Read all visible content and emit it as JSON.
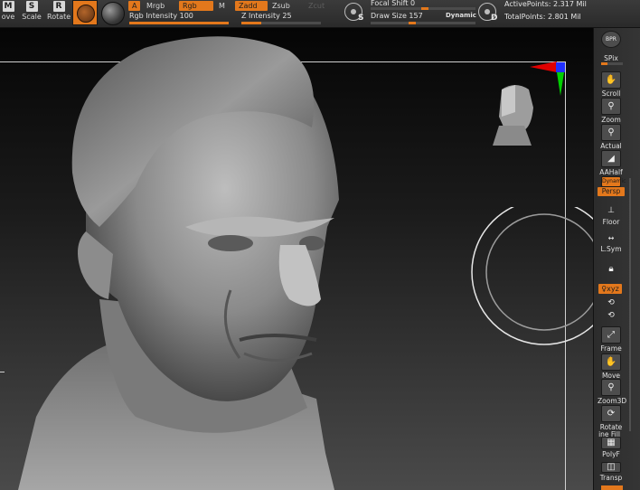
{
  "toolbar": {
    "move_label": "ove",
    "scale_label": "Scale",
    "rotate_label": "Rotate",
    "move_key": "M",
    "scale_key": "S",
    "rotate_key": "R",
    "a_label": "A",
    "mrgb_label": "Mrgb",
    "rgb_label": "Rgb",
    "m_label": "M",
    "zadd_label": "Zadd",
    "zsub_label": "Zsub",
    "zcut_label": "Zcut",
    "rgb_intensity_label": "Rgb Intensity 100",
    "rgb_intensity_value": 100,
    "z_intensity_label": "Z Intensity 25",
    "z_intensity_value": 25,
    "focal_shift_label": "Focal Shift 0",
    "focal_shift_value": 0,
    "draw_size_label": "Draw Size 157",
    "draw_size_value": 157,
    "dynamic_label": "Dynamic",
    "s_key": "S",
    "d_key": "D",
    "active_points": "ActivePoints: 2.317 Mil",
    "total_points": "TotalPoints: 2.801 Mil"
  },
  "righttray": {
    "bpr_label": "BPR",
    "spix_label": "SPix",
    "scroll_label": "Scroll",
    "zoom_label": "Zoom",
    "actual_label": "Actual",
    "aahalf_label": "AAHalf",
    "dynamic_label": "Dynamic",
    "persp_label": "Persp",
    "floor_label": "Floor",
    "lsym_label": "L.Sym",
    "xyz_label": "♀xyz",
    "frame_label": "Frame",
    "move_label": "Move",
    "zoom3d_label": "Zoom3D",
    "rotate_label": "Rotate",
    "linefill_label": "ine Fill",
    "polyf_label": "PolyF",
    "transp_label": "Transp"
  },
  "colors": {
    "accent": "#e3781c",
    "axis_red": "#e00000",
    "axis_green": "#00d000",
    "axis_blue": "#2030ff"
  },
  "icons": [
    "move-icon",
    "scale-icon",
    "rotate-icon",
    "material-icon",
    "texture-icon",
    "focal-circle-icon",
    "draw-circle-icon",
    "bpr-icon",
    "scroll-icon",
    "zoom-icon",
    "actual-icon",
    "aahalf-icon",
    "persp-icon",
    "floor-icon",
    "lsym-icon",
    "lock-icon",
    "frame-icon",
    "move3d-icon",
    "zoom3d-icon",
    "rotate3d-icon",
    "polyf-icon",
    "transp-icon"
  ]
}
